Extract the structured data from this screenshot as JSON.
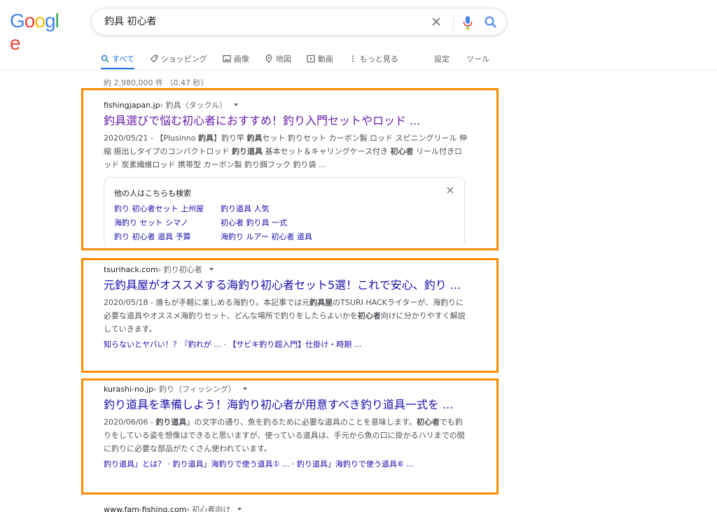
{
  "logo": "Google",
  "search": {
    "query": "釣具 初心者"
  },
  "tabs": [
    {
      "label": "すべて",
      "icon": "search-icon",
      "active": true
    },
    {
      "label": "ショッピング",
      "icon": "tag-icon"
    },
    {
      "label": "画像",
      "icon": "image-icon"
    },
    {
      "label": "地図",
      "icon": "map-pin-icon"
    },
    {
      "label": "動画",
      "icon": "play-icon"
    },
    {
      "label": "もっと見る",
      "icon": "more-icon"
    }
  ],
  "tools": {
    "settings": "設定",
    "tools": "ツール"
  },
  "stats": "約 2,980,000 件 （0.47 秒）",
  "results": [
    {
      "domain": "fishingjapan.jp",
      "crumb": " › 釣具（タックル）",
      "title": "釣具選びで悩む初心者におすすめ！釣り入門セットやロッド ...",
      "snippet_html": "2020/05/21 - 【Plusinno <b>釣具</b>】釣り竿 <b>釣具</b>セット 釣りセット カーボン製 ロッド スピニングリール 伸縮 振出しタイプのコンパクトロッド <b>釣り道具</b> 基本セット＆キャリングケース付き <b>初心者</b> リール付きロッド 炭素繊維ロッド 携帯型 カーボン製 釣り餌フック 釣り袋 ..."
    },
    {
      "domain": "tsurihack.com",
      "crumb": " › 釣り初心者",
      "title": "元釣具屋がオススメする海釣り初心者セット5選！これで安心、釣り ...",
      "snippet_html": "2020/05/18 - 誰もが手軽に楽しめる海釣り。本記事では元<b>釣具屋</b>のTSURI HACKライターが、海釣りに必要な道具やオススメ海釣りセット、どんな場所で釣りをしたらよいかを<b>初心者</b>向けに分かりやすく解説していきます。",
      "sitelinks": "知らないとヤバい！？『釣れが ... · 【サビキ釣り超入門】仕掛け・時期 ..."
    },
    {
      "domain": "kurashi-no.jp",
      "crumb": " › 釣り（フィッシング）",
      "title": "釣り道具を準備しよう！海釣り初心者が用意すべき釣り道具一式を ...",
      "snippet_html": "2020/06/06 - <b>釣り道具</b>」の文字の通り、魚を釣るために必要な道具のことを意味します。<b>初心者</b>でも釣りをしている姿を想像はできると思いますが、使っている道具は、手元から魚の口に掛かるハリまでの間に釣りに必要な部品がたくさん使われています。",
      "sitelinks": "釣り道具」とは？ · 釣り道具」海釣りで使う道具① ... · 釣り道具」海釣りで使う道具⑥ ..."
    },
    {
      "domain": "www.fam-fishing.com",
      "crumb": " › 初心者向け"
    }
  ],
  "related": {
    "title": "他の人はこちらも検索",
    "items": [
      "釣り 初心者セット 上州屋",
      "釣り道具 人気",
      "海釣り セット シマノ",
      "初心者 釣り具 一式",
      "釣り 初心者 道具 予算",
      "海釣り ルアー 初心者 道具"
    ]
  },
  "colors": {
    "highlight": "#ff8c00",
    "link": "#1a0dab",
    "visited": "#681da8"
  }
}
